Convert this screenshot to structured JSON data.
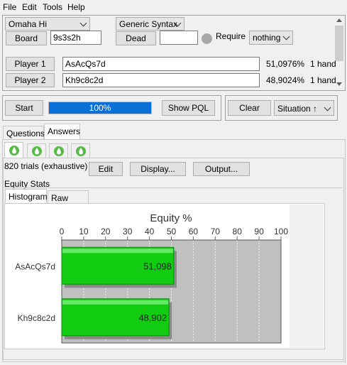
{
  "menu": [
    "File",
    "Edit",
    "Tools",
    "Help"
  ],
  "setup": {
    "game": "Omaha Hi",
    "syntax": "Generic Syntax",
    "board_label": "Board",
    "board_value": "9s3s2h",
    "dead_label": "Dead",
    "dead_value": "",
    "require_label": "Require",
    "require_value": "nothing"
  },
  "players": [
    {
      "label": "Player 1",
      "hand": "AsAcQs7d",
      "equity": "51,0976%",
      "count": "1 hand"
    },
    {
      "label": "Player 2",
      "hand": "Kh9c8c2d",
      "equity": "48,9024%",
      "count": "1 hand"
    }
  ],
  "controls": {
    "start": "Start",
    "progress_text": "100%",
    "progress": 1.0,
    "show_pql": "Show PQL",
    "clear": "Clear",
    "situation": "Situation ↑"
  },
  "tabs": {
    "questions": "Questions",
    "answers": "Answers"
  },
  "results": {
    "trials": "820 trials (exhaustive)",
    "edit": "Edit",
    "display": "Display...",
    "output": "Output...",
    "section": "Equity Stats",
    "subtabs": {
      "histogram": "Histogram",
      "raw": "Raw Data"
    }
  },
  "colors": {
    "bar": "#11cc11",
    "accent": "#0078d7",
    "drop": "#55bb44"
  },
  "chart_data": {
    "type": "bar",
    "title": "Equity %",
    "orientation": "horizontal",
    "categories": [
      "AsAcQs7d",
      "Kh9c8c2d"
    ],
    "values": [
      51.098,
      48.902
    ],
    "value_labels": [
      "51,098",
      "48,902"
    ],
    "xlim": [
      0,
      100
    ],
    "ticks": [
      "0",
      "10",
      "20",
      "30",
      "40",
      "50",
      "60",
      "70",
      "80",
      "90",
      "100"
    ],
    "grid": true
  }
}
